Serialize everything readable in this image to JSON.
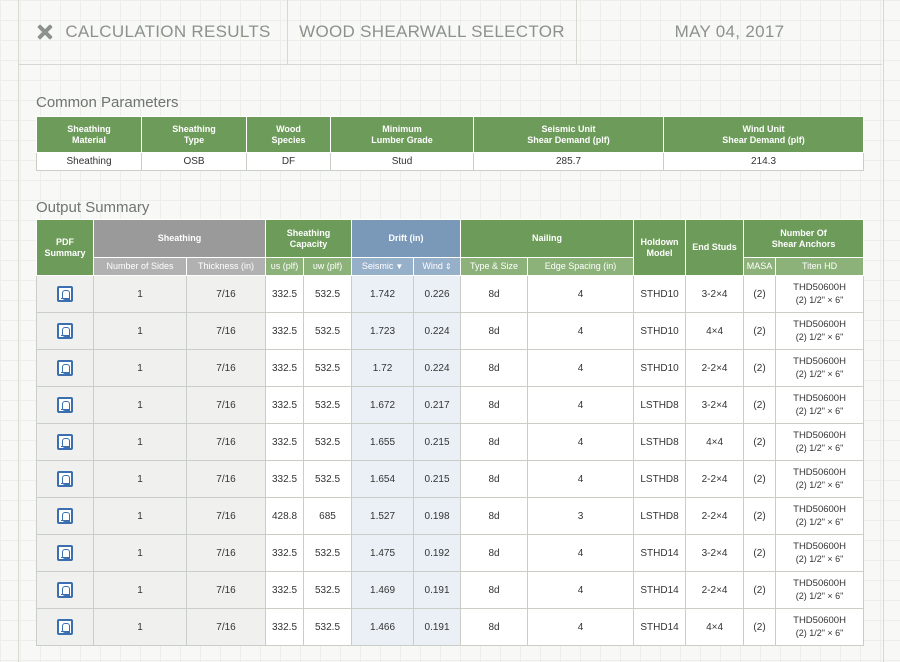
{
  "header": {
    "title": "CALCULATION RESULTS",
    "selector": "WOOD SHEARWALL SELECTOR",
    "date": "MAY 04, 2017",
    "close_icon": "x-icon"
  },
  "common": {
    "title": "Common Parameters",
    "headers": [
      [
        "Sheathing",
        "Material"
      ],
      [
        "Sheathing",
        "Type"
      ],
      [
        "Wood",
        "Species"
      ],
      [
        "Minimum",
        "Lumber Grade"
      ],
      [
        "Seismic Unit",
        "Shear Demand (plf)"
      ],
      [
        "Wind Unit",
        "Shear Demand (plf)"
      ]
    ],
    "values": [
      "Sheathing",
      "OSB",
      "DF",
      "Stud",
      "285.7",
      "214.3"
    ]
  },
  "output": {
    "title": "Output Summary",
    "groups": {
      "pdf": [
        "PDF",
        "Summary"
      ],
      "sheathing": "Sheathing",
      "capacity": [
        "Sheathing",
        "Capacity"
      ],
      "drift": "Drift (in)",
      "nailing": "Nailing",
      "holdown": [
        "Holdown",
        "Model"
      ],
      "end_studs": "End Studs",
      "anchors": [
        "Number Of",
        "Shear Anchors"
      ]
    },
    "subheaders": {
      "sides": "Number of Sides",
      "thickness": "Thickness (in)",
      "vs": "υs (plf)",
      "vw": "υw (plf)",
      "seismic": "Seismic",
      "wind": "Wind",
      "type_size": "Type & Size",
      "edge_spacing": "Edge Spacing (in)",
      "masa": "MASA",
      "titen": "Titen HD"
    },
    "rows": [
      {
        "sides": "1",
        "thick": "7/16",
        "vs": "332.5",
        "vw": "532.5",
        "seismic": "1.742",
        "wind": "0.226",
        "nail": "8d",
        "edge": "4",
        "holdown": "STHD10",
        "studs": "3-2×4",
        "masa": "(2)",
        "titen1": "THD50600H",
        "titen2": "(2) 1/2\" × 6\""
      },
      {
        "sides": "1",
        "thick": "7/16",
        "vs": "332.5",
        "vw": "532.5",
        "seismic": "1.723",
        "wind": "0.224",
        "nail": "8d",
        "edge": "4",
        "holdown": "STHD10",
        "studs": "4×4",
        "masa": "(2)",
        "titen1": "THD50600H",
        "titen2": "(2) 1/2\" × 6\""
      },
      {
        "sides": "1",
        "thick": "7/16",
        "vs": "332.5",
        "vw": "532.5",
        "seismic": "1.72",
        "wind": "0.224",
        "nail": "8d",
        "edge": "4",
        "holdown": "STHD10",
        "studs": "2-2×4",
        "masa": "(2)",
        "titen1": "THD50600H",
        "titen2": "(2) 1/2\" × 6\""
      },
      {
        "sides": "1",
        "thick": "7/16",
        "vs": "332.5",
        "vw": "532.5",
        "seismic": "1.672",
        "wind": "0.217",
        "nail": "8d",
        "edge": "4",
        "holdown": "LSTHD8",
        "studs": "3-2×4",
        "masa": "(2)",
        "titen1": "THD50600H",
        "titen2": "(2) 1/2\" × 6\""
      },
      {
        "sides": "1",
        "thick": "7/16",
        "vs": "332.5",
        "vw": "532.5",
        "seismic": "1.655",
        "wind": "0.215",
        "nail": "8d",
        "edge": "4",
        "holdown": "LSTHD8",
        "studs": "4×4",
        "masa": "(2)",
        "titen1": "THD50600H",
        "titen2": "(2) 1/2\" × 6\""
      },
      {
        "sides": "1",
        "thick": "7/16",
        "vs": "332.5",
        "vw": "532.5",
        "seismic": "1.654",
        "wind": "0.215",
        "nail": "8d",
        "edge": "4",
        "holdown": "LSTHD8",
        "studs": "2-2×4",
        "masa": "(2)",
        "titen1": "THD50600H",
        "titen2": "(2) 1/2\" × 6\""
      },
      {
        "sides": "1",
        "thick": "7/16",
        "vs": "428.8",
        "vw": "685",
        "seismic": "1.527",
        "wind": "0.198",
        "nail": "8d",
        "edge": "3",
        "holdown": "LSTHD8",
        "studs": "2-2×4",
        "masa": "(2)",
        "titen1": "THD50600H",
        "titen2": "(2) 1/2\" × 6\""
      },
      {
        "sides": "1",
        "thick": "7/16",
        "vs": "332.5",
        "vw": "532.5",
        "seismic": "1.475",
        "wind": "0.192",
        "nail": "8d",
        "edge": "4",
        "holdown": "STHD14",
        "studs": "3-2×4",
        "masa": "(2)",
        "titen1": "THD50600H",
        "titen2": "(2) 1/2\" × 6\""
      },
      {
        "sides": "1",
        "thick": "7/16",
        "vs": "332.5",
        "vw": "532.5",
        "seismic": "1.469",
        "wind": "0.191",
        "nail": "8d",
        "edge": "4",
        "holdown": "STHD14",
        "studs": "2-2×4",
        "masa": "(2)",
        "titen1": "THD50600H",
        "titen2": "(2) 1/2\" × 6\""
      },
      {
        "sides": "1",
        "thick": "7/16",
        "vs": "332.5",
        "vw": "532.5",
        "seismic": "1.466",
        "wind": "0.191",
        "nail": "8d",
        "edge": "4",
        "holdown": "STHD14",
        "studs": "4×4",
        "masa": "(2)",
        "titen1": "THD50600H",
        "titen2": "(2) 1/2\" × 6\""
      }
    ]
  }
}
